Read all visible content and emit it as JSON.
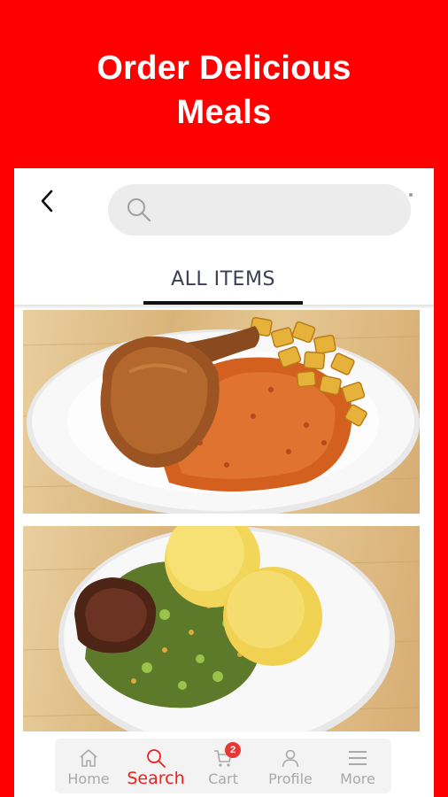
{
  "promo": {
    "title_line1": "Order Delicious",
    "title_line2": "Meals"
  },
  "header": {
    "back_icon": "chevron-left-icon",
    "search": {
      "placeholder": "",
      "value": ""
    }
  },
  "tabs": [
    {
      "label": "ALL ITEMS",
      "active": true
    }
  ],
  "meals": [
    {
      "image": "fried-chicken-jollof-rice-plantain"
    },
    {
      "image": "goat-meat-vegetable-soup-swallow"
    }
  ],
  "bottom_nav": {
    "home": "Home",
    "search": "Search",
    "cart": "Cart",
    "cart_count": "2",
    "profile": "Profile",
    "more": "More"
  },
  "colors": {
    "brand": "#fe0000",
    "active_nav": "#f21d1d",
    "badge": "#e53935"
  }
}
